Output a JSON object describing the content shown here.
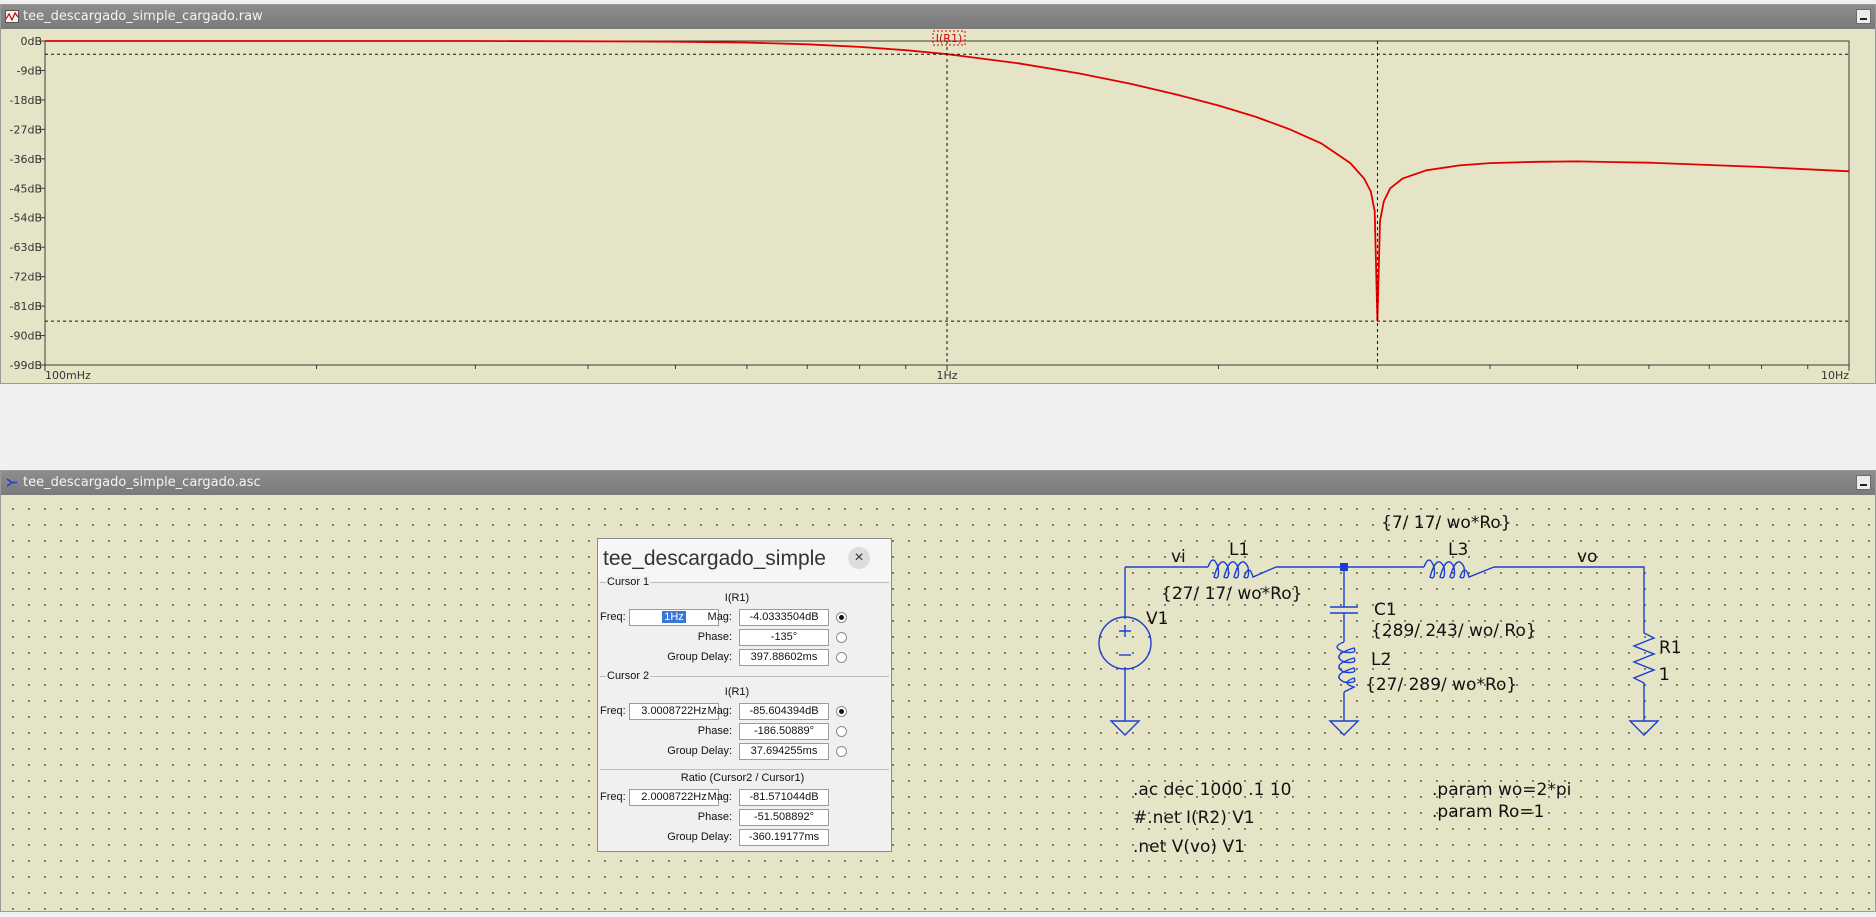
{
  "plot_window": {
    "title": "tee_descargado_simple_cargado.raw",
    "trace_label": "I(R1)",
    "trace_color": "#e00000"
  },
  "schematic_window": {
    "title": "tee_descargado_simple_cargado.asc",
    "wire_color": "#1a3fd0",
    "labels": {
      "vi": "vi",
      "vo": "vo",
      "L1": "L1",
      "L1_value": "{27/ 17/ wo*Ro}",
      "L3": "L3",
      "L3_value": "{7/ 17/ wo*Ro}",
      "C1": "C1",
      "C1_value": "{289/ 243/ wo/ Ro}",
      "L2": "L2",
      "L2_value": "{27/ 289/ wo*Ro}",
      "V1": "V1",
      "R1": "R1",
      "R1_value": "1"
    },
    "directives": {
      "ac": ".ac dec 1000 .1 10",
      "net_comment": "#.net I(R2) V1",
      "net": ".net V(vo) V1",
      "param_wo": ".param wo=2*pi",
      "param_ro": ".param Ro=1"
    }
  },
  "cursor_dialog": {
    "title": "tee_descargado_simple",
    "cursor1": {
      "group": "Cursor 1",
      "trace": "I(R1)",
      "freq_label": "Freq:",
      "freq": "1Hz",
      "mag_label": "Mag:",
      "mag": "-4.0333504dB",
      "phase_label": "Phase:",
      "phase": "-135°",
      "gd_label": "Group Delay:",
      "group_delay": "397.88602ms"
    },
    "cursor2": {
      "group": "Cursor 2",
      "trace": "I(R1)",
      "freq_label": "Freq:",
      "freq": "3.0008722Hz",
      "mag_label": "Mag:",
      "mag": "-85.604394dB",
      "phase_label": "Phase:",
      "phase": "-186.50889°",
      "gd_label": "Group Delay:",
      "group_delay": "37.694255ms"
    },
    "ratio": {
      "group": "Ratio (Cursor2 / Cursor1)",
      "freq_label": "Freq:",
      "freq": "2.0008722Hz",
      "mag_label": "Mag:",
      "mag": "-81.571044dB",
      "phase_label": "Phase:",
      "phase": "-51.508892°",
      "gd_label": "Group Delay:",
      "group_delay": "-360.19177ms"
    }
  },
  "chart_data": {
    "type": "line",
    "series": [
      {
        "name": "I(R1)",
        "x": [
          0.1,
          0.2,
          0.3,
          0.4,
          0.5,
          0.6,
          0.7,
          0.8,
          0.9,
          1.0,
          1.2,
          1.4,
          1.6,
          1.8,
          2.0,
          2.2,
          2.4,
          2.6,
          2.8,
          2.9,
          2.95,
          2.98,
          3.0,
          3.02,
          3.05,
          3.1,
          3.2,
          3.4,
          3.7,
          4.0,
          4.5,
          5.0,
          5.5,
          6.0,
          7.0,
          8.0,
          9.0,
          10.0
        ],
        "y": [
          0,
          0,
          0,
          -0.1,
          -0.2,
          -0.5,
          -1.0,
          -1.8,
          -2.8,
          -4.0,
          -6.8,
          -9.9,
          -13.1,
          -16.4,
          -19.7,
          -23.2,
          -27.0,
          -31.3,
          -37.3,
          -42.0,
          -46.0,
          -52.0,
          -85.6,
          -55.0,
          -49.0,
          -45.0,
          -42.0,
          -39.5,
          -38.0,
          -37.3,
          -36.9,
          -36.8,
          -37.0,
          -37.2,
          -37.9,
          -38.5,
          -39.2,
          -39.8
        ]
      }
    ],
    "xscale": "log",
    "x_ticks": [
      "100mHz",
      "1Hz",
      "10Hz"
    ],
    "y_ticks": [
      "0dB",
      "-9dB",
      "-18dB",
      "-27dB",
      "-36dB",
      "-45dB",
      "-54dB",
      "-63dB",
      "-72dB",
      "-81dB",
      "-90dB",
      "-99dB"
    ],
    "xlim": [
      0.1,
      10
    ],
    "ylim": [
      -99,
      0
    ],
    "cursor1": {
      "x": 1.0,
      "y": -4.0333504
    },
    "cursor2": {
      "x": 3.0008722,
      "y": -85.604394
    }
  }
}
